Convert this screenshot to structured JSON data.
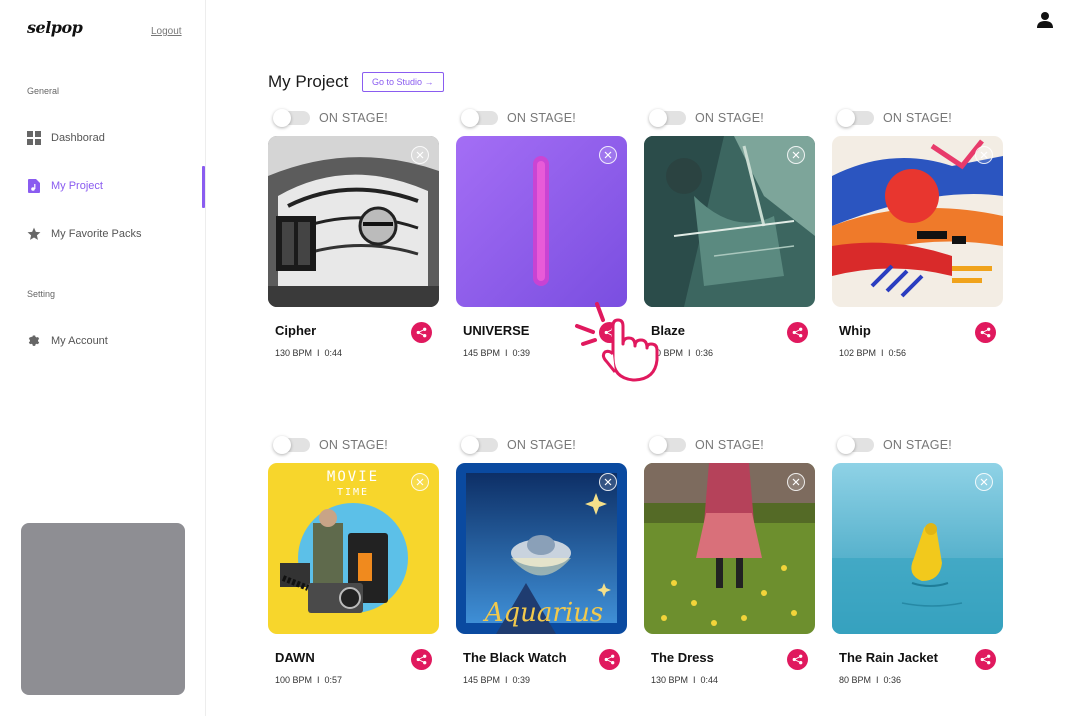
{
  "sidebar": {
    "logo": "selpop",
    "logout_label": "Logout",
    "general_label": "General",
    "setting_label": "Setting",
    "items": [
      {
        "label": "Dashborad",
        "icon": "grid-icon"
      },
      {
        "label": "My Project",
        "icon": "music-file-icon",
        "active": true
      },
      {
        "label": "My Favorite Packs",
        "icon": "star-icon"
      },
      {
        "label": "My Account",
        "icon": "gear-icon"
      }
    ]
  },
  "header": {
    "user_icon": "user-icon"
  },
  "main": {
    "title": "My Project",
    "studio_button": "Go to Studio →",
    "toggle_label": "ON STAGE!",
    "projects": [
      {
        "name": "Cipher",
        "bpm": "130 BPM",
        "duration": "0:44",
        "on_stage": false
      },
      {
        "name": "UNIVERSE",
        "bpm": "145 BPM",
        "duration": "0:39",
        "on_stage": false
      },
      {
        "name": "Blaze",
        "bpm": "60 BPM",
        "duration": "0:36",
        "on_stage": false
      },
      {
        "name": "Whip",
        "bpm": "102 BPM",
        "duration": "0:56",
        "on_stage": false
      },
      {
        "name": "DAWN",
        "bpm": "100 BPM",
        "duration": "0:57",
        "on_stage": false
      },
      {
        "name": "The Black Watch",
        "bpm": "145 BPM",
        "duration": "0:39",
        "on_stage": false
      },
      {
        "name": "The Dress",
        "bpm": "130 BPM",
        "duration": "0:44",
        "on_stage": false
      },
      {
        "name": "The Rain Jacket",
        "bpm": "80 BPM",
        "duration": "0:36",
        "on_stage": false
      }
    ],
    "cover_text": {
      "dawn_line1": "MOVIE",
      "dawn_line2": "TIME",
      "black_watch": "Aquarius"
    }
  },
  "colors": {
    "accent": "#8a5cf0",
    "share": "#e0195e",
    "cursor_hand": "#e0195e"
  }
}
